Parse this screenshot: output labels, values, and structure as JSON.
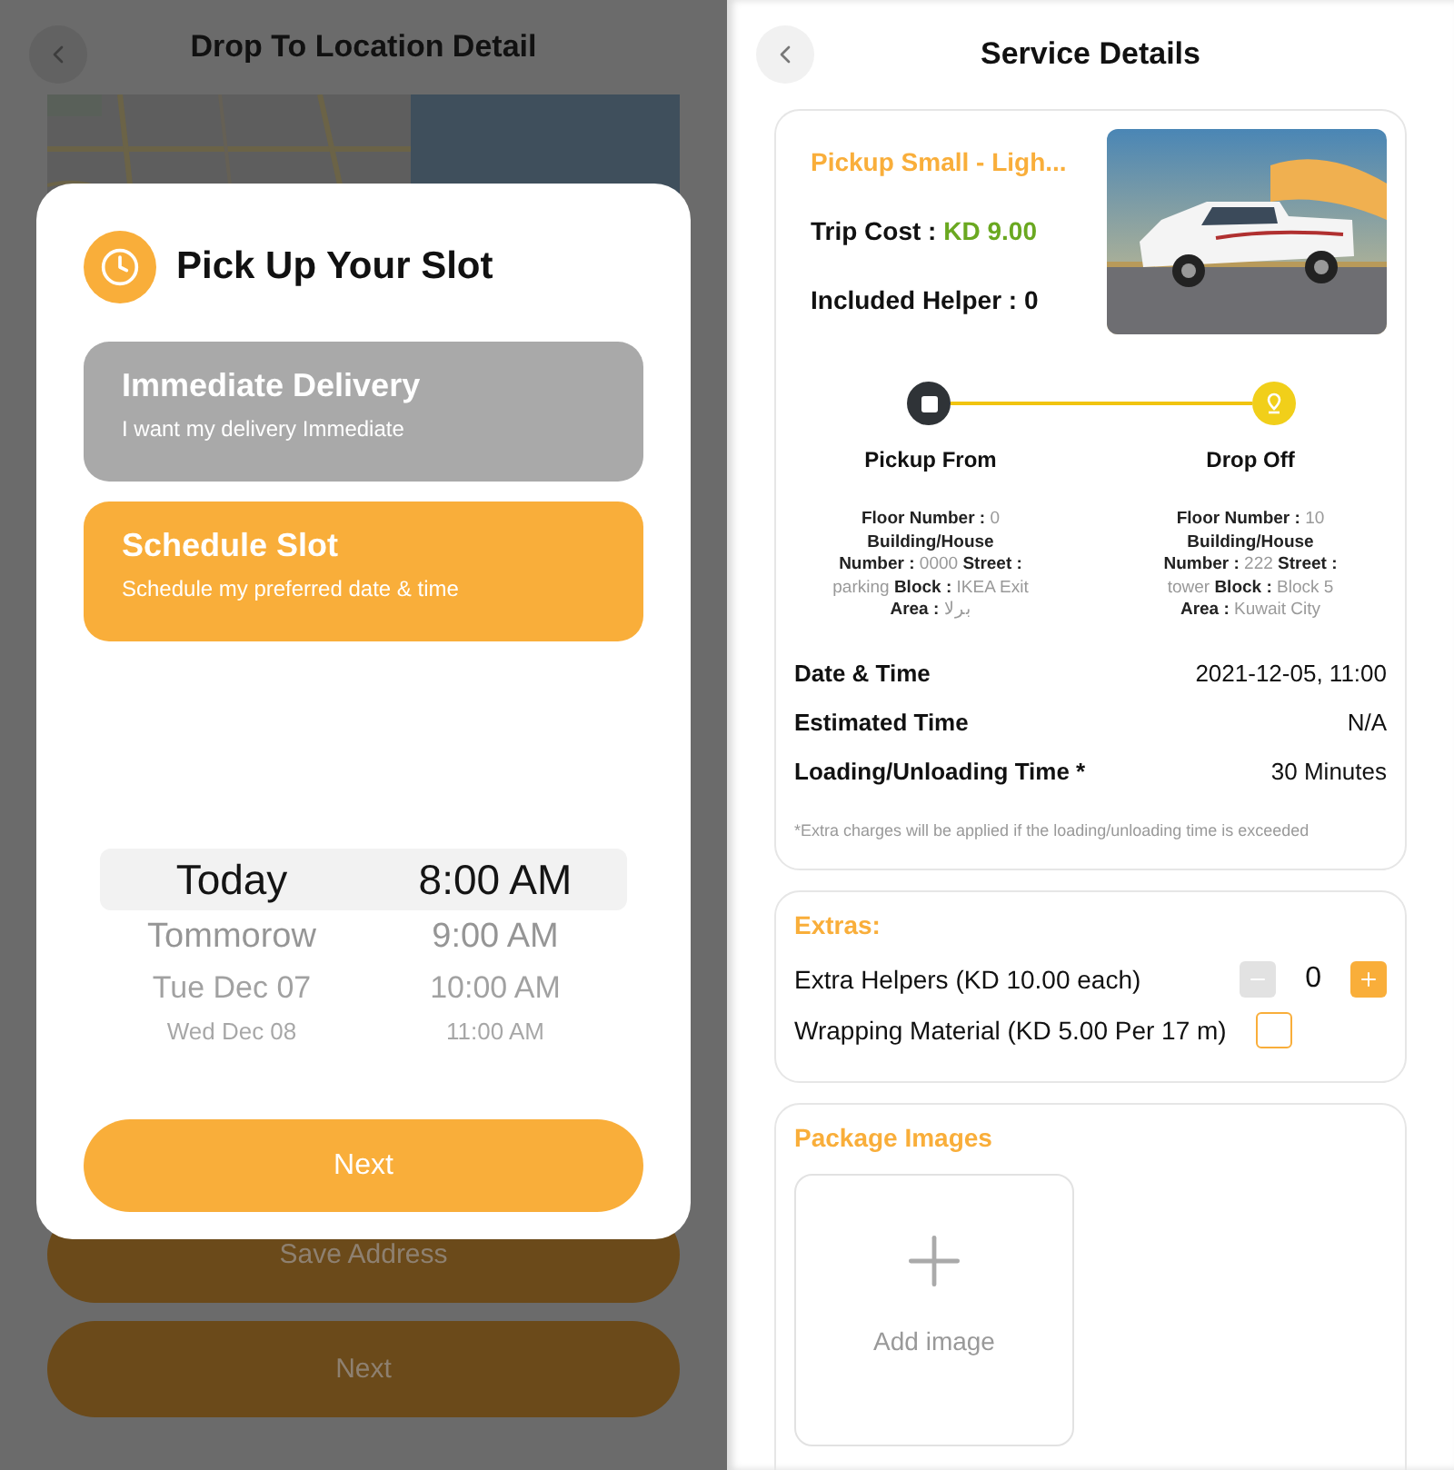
{
  "location_screen": {
    "title": "Drop To Location Detail",
    "buttons": [
      "Save Address",
      "Next"
    ]
  },
  "slot_dialog": {
    "title": "Pick Up Your Slot",
    "options": [
      {
        "title": "Immediate Delivery",
        "subtitle": "I want my delivery Immediate",
        "selected": false
      },
      {
        "title": "Schedule Slot",
        "subtitle": "Schedule my preferred date & time",
        "selected": true
      }
    ],
    "picker_rows": [
      {
        "day": "Today",
        "time": "8:00 AM",
        "selected": true
      },
      {
        "day": "Tommorow",
        "time": "9:00 AM",
        "selected": false
      },
      {
        "day": "Tue Dec 07",
        "time": "10:00 AM",
        "selected": false
      },
      {
        "day": "Wed Dec 08",
        "time": "11:00 AM",
        "selected": false
      }
    ],
    "button": "Next"
  },
  "service_screen": {
    "title": "Service Details",
    "vehicle": {
      "name": "Pickup Small - Ligh...",
      "trip_cost_label": "Trip Cost :",
      "trip_cost": "KD 9.00",
      "helper": "Included Helper : 0"
    },
    "route": [
      {
        "label": "Pickup From",
        "address": "**Floor Number :** 0 **Building/House Number :** 0000 **Street :** parking **Block :** IKEA Exit **Area :** برلا"
      },
      {
        "label": "Drop Off",
        "address": "**Floor Number :** 10 **Building/House Number :** 222 **Street :** tower **Block :** Block 5 **Area :** Kuwait City"
      }
    ],
    "details": [
      {
        "label": "Date & Time",
        "value": "2021-12-05, 11:00"
      },
      {
        "label": "Estimated Time",
        "value": "N/A"
      },
      {
        "label": "Loading/Unloading Time *",
        "value": "30 Minutes"
      }
    ],
    "note": "*Extra charges will be applied if the loading/unloading time is exceeded",
    "extras": {
      "title": "Extras:",
      "items": [
        {
          "kind": "counter",
          "label": "Extra Helpers (KD 10.00 each)",
          "value": "0",
          "minus_disabled": true
        },
        {
          "kind": "checkbox",
          "label": "Wrapping Material (KD 5.00 Per 17 m)",
          "checked": false
        }
      ]
    },
    "package_images": {
      "title": "Package Images",
      "add_label": "Add image"
    }
  }
}
